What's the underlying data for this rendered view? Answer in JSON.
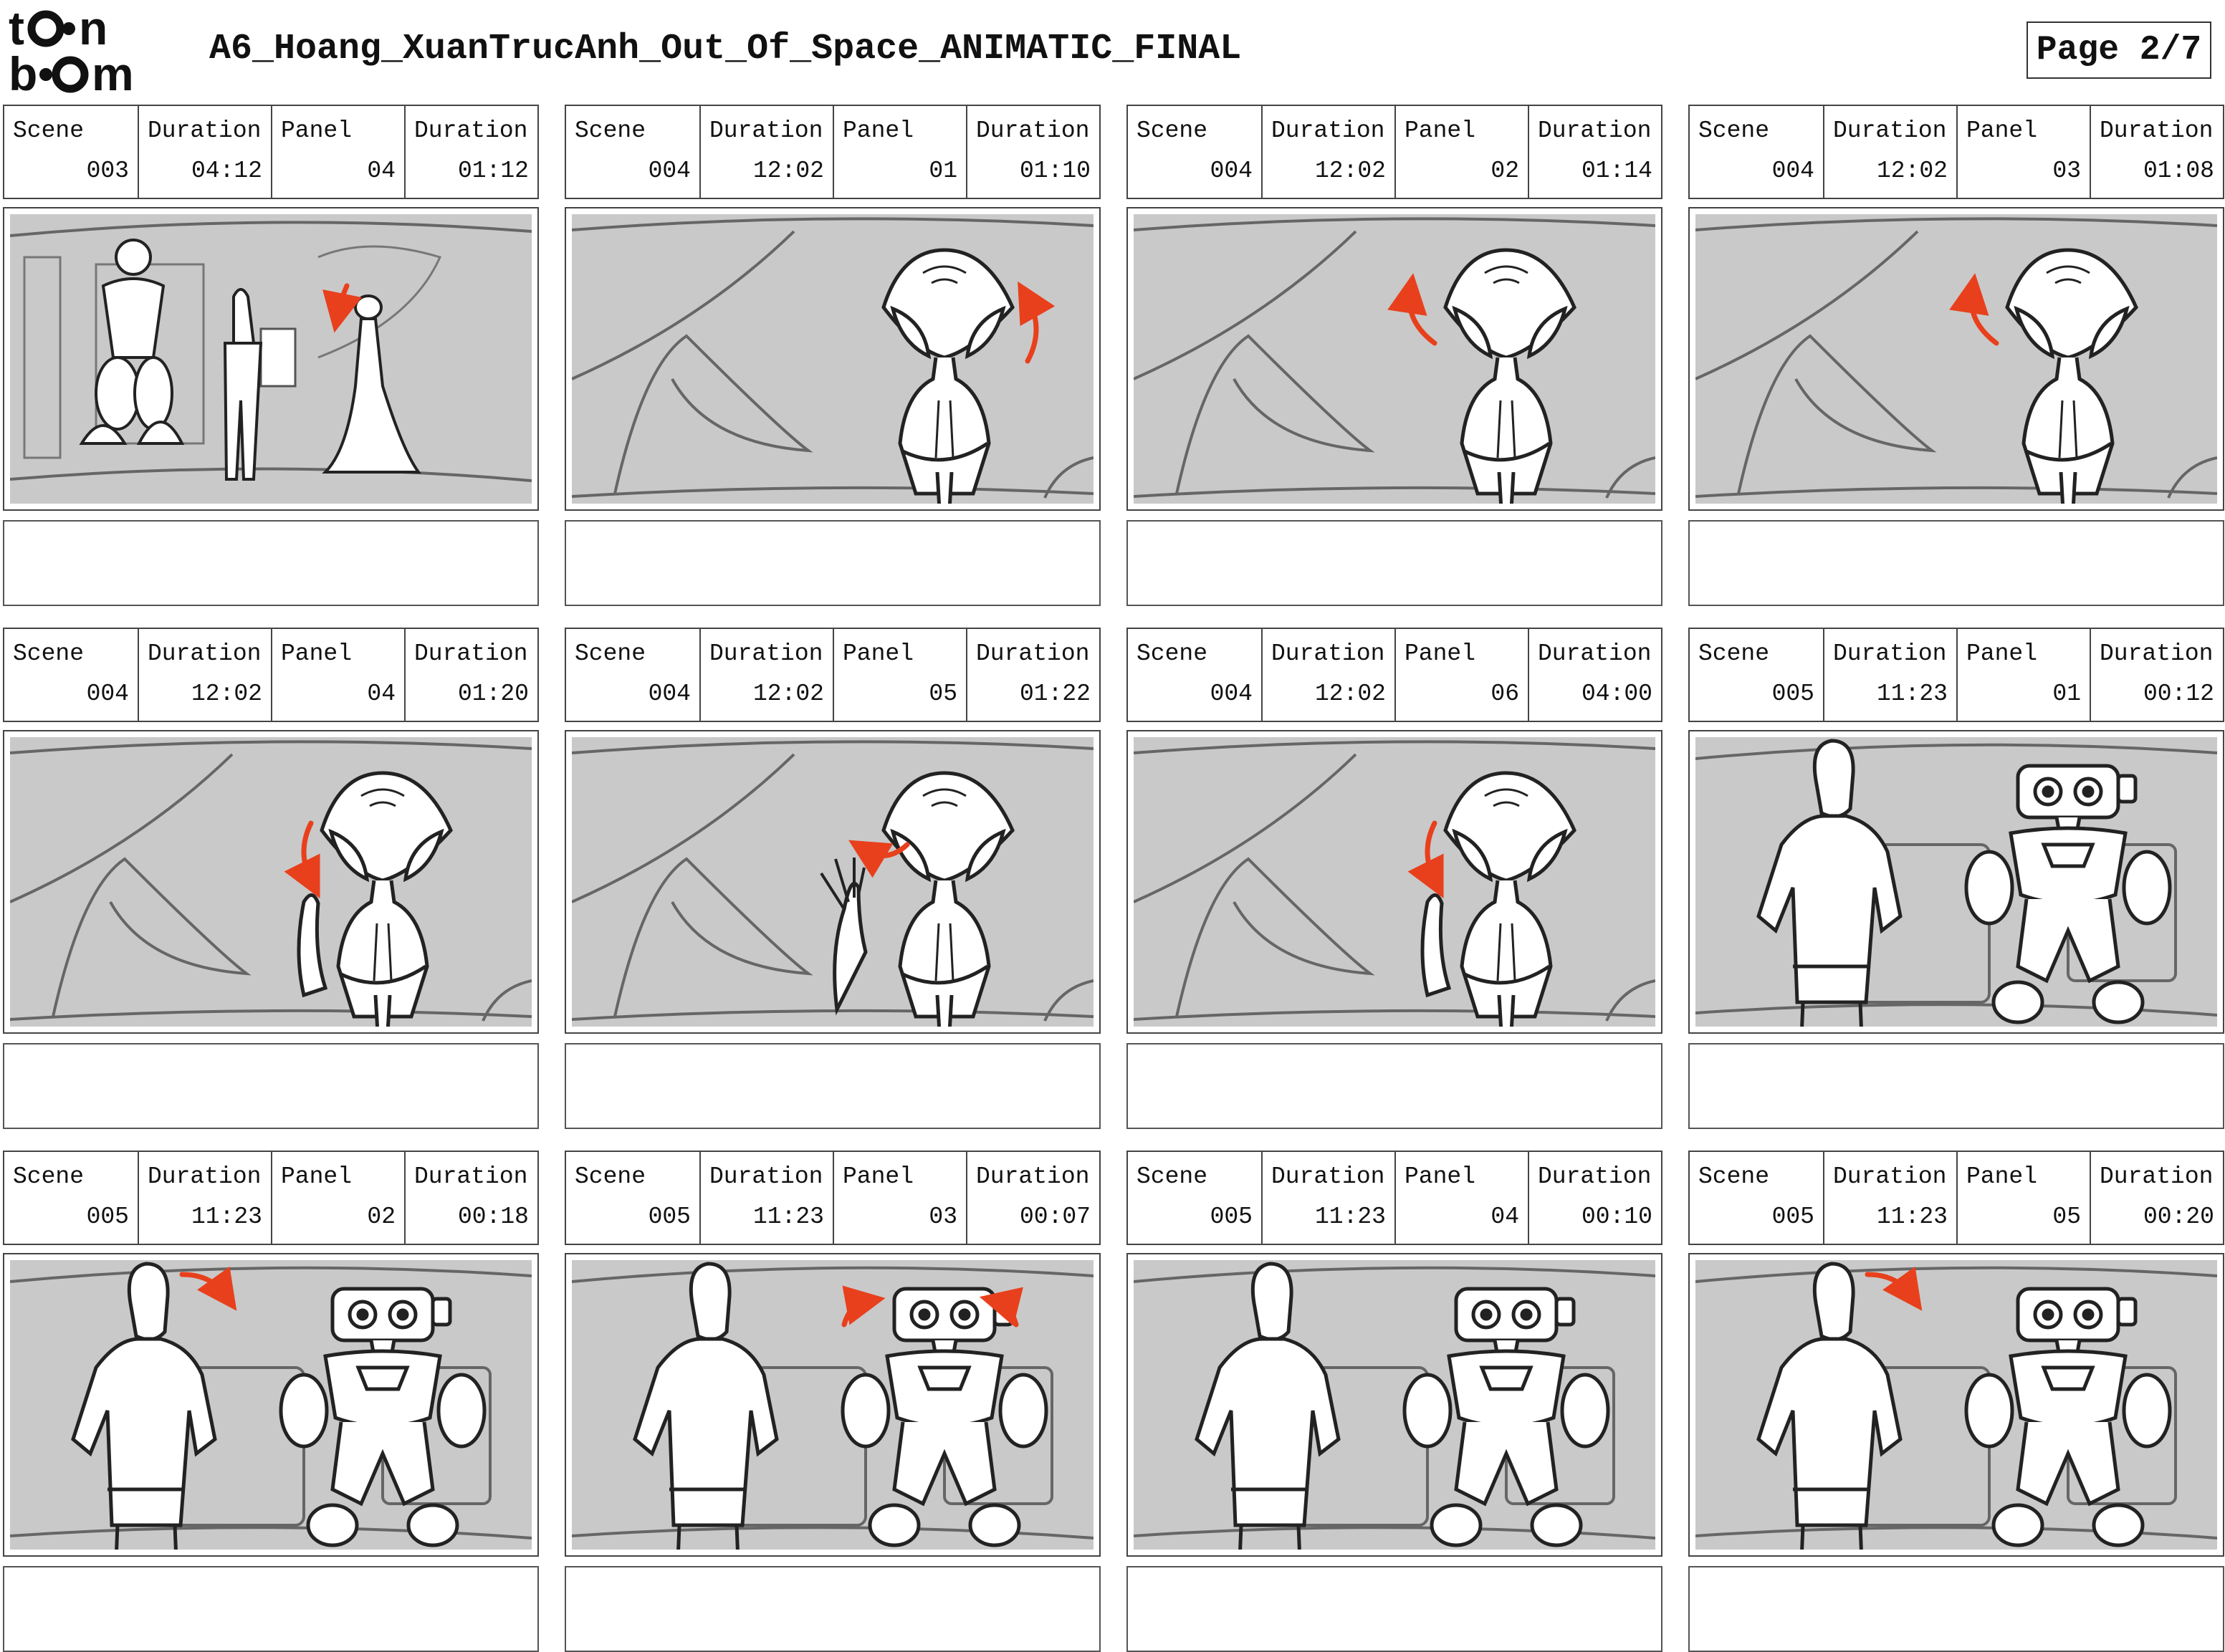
{
  "header": {
    "logo_text": "toonboom",
    "title": "A6_Hoang_XuanTrucAnh_Out_Of_Space_ANIMATIC_FINAL",
    "page": "Page 2/7"
  },
  "labels": {
    "scene": "Scene",
    "duration": "Duration",
    "panel": "Panel"
  },
  "panels": [
    {
      "scene": "003",
      "scene_duration": "04:12",
      "panel": "04",
      "panel_duration": "01:12",
      "drawing": "wide-room-shot"
    },
    {
      "scene": "004",
      "scene_duration": "12:02",
      "panel": "01",
      "panel_duration": "01:10",
      "drawing": "alien-closeup-arrow-right-up"
    },
    {
      "scene": "004",
      "scene_duration": "12:02",
      "panel": "02",
      "panel_duration": "01:14",
      "drawing": "alien-closeup-arrow-left-up"
    },
    {
      "scene": "004",
      "scene_duration": "12:02",
      "panel": "03",
      "panel_duration": "01:08",
      "drawing": "alien-closeup-arrow-left-up"
    },
    {
      "scene": "004",
      "scene_duration": "12:02",
      "panel": "04",
      "panel_duration": "01:20",
      "drawing": "alien-closeup-arrow-down"
    },
    {
      "scene": "004",
      "scene_duration": "12:02",
      "panel": "05",
      "panel_duration": "01:22",
      "drawing": "alien-closeup-hand-wave"
    },
    {
      "scene": "004",
      "scene_duration": "12:02",
      "panel": "06",
      "panel_duration": "04:00",
      "drawing": "alien-closeup-arrow-down"
    },
    {
      "scene": "005",
      "scene_duration": "11:23",
      "panel": "01",
      "panel_duration": "00:12",
      "drawing": "man-and-robot"
    },
    {
      "scene": "005",
      "scene_duration": "11:23",
      "panel": "02",
      "panel_duration": "00:18",
      "drawing": "man-and-robot-head-turn"
    },
    {
      "scene": "005",
      "scene_duration": "11:23",
      "panel": "03",
      "panel_duration": "00:07",
      "drawing": "man-and-robot-arms-raise"
    },
    {
      "scene": "005",
      "scene_duration": "11:23",
      "panel": "04",
      "panel_duration": "00:10",
      "drawing": "man-and-robot"
    },
    {
      "scene": "005",
      "scene_duration": "11:23",
      "panel": "05",
      "panel_duration": "00:20",
      "drawing": "man-and-robot-head-turn"
    }
  ],
  "colors": {
    "frame_bg": "#c9c9c9",
    "line": "#222222",
    "arrow": "#e8401c",
    "border": "#444444"
  }
}
